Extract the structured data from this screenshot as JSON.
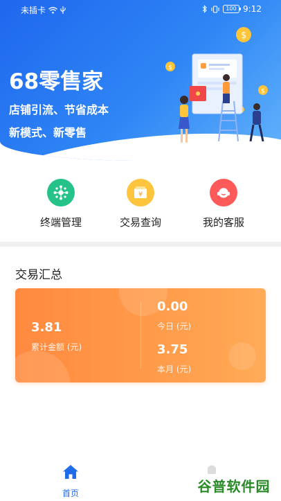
{
  "status_bar": {
    "carrier": "未插卡",
    "battery": "100",
    "time": "9:12"
  },
  "banner": {
    "app_title": "68零售家",
    "slogan_line1": "店铺引流、节省成本",
    "slogan_line2": "新模式、新零售"
  },
  "quick_actions": [
    {
      "label": "终端管理",
      "icon": "terminal-hub-icon",
      "color": "#25c28a"
    },
    {
      "label": "交易查询",
      "icon": "transaction-yen-icon",
      "color": "#ffc43d"
    },
    {
      "label": "我的客服",
      "icon": "customer-service-icon",
      "color": "#ff5a5a"
    }
  ],
  "summary": {
    "title": "交易汇总",
    "cumulative_value": "3.81",
    "cumulative_label": "累计金额 (元)",
    "today_value": "0.00",
    "today_label": "今日 (元)",
    "month_value": "3.75",
    "month_label": "本月 (元)"
  },
  "bottom_nav": {
    "home_label": "首页",
    "accent": "#1f6be8"
  },
  "watermark": "谷普软件园"
}
